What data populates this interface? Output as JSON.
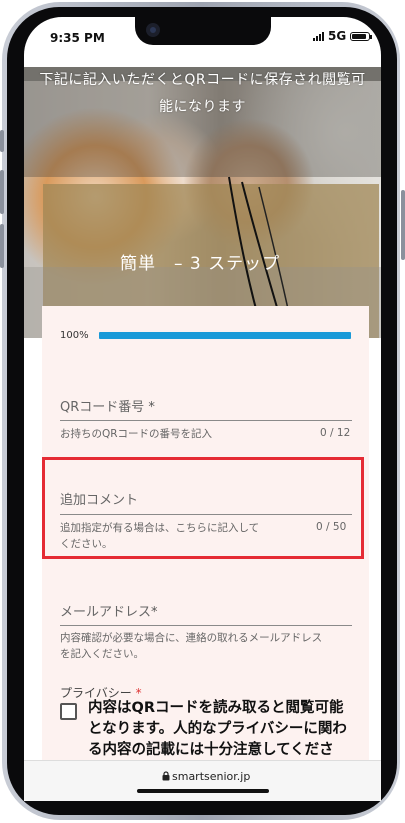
{
  "status_bar": {
    "time": "9:35 PM",
    "network": "5G"
  },
  "hero": {
    "intro_line1": "下記に記入いただくとQRコードに保存され閲覧可",
    "intro_line2": "能になります",
    "steps_title": "簡単　– 3 ステップ"
  },
  "progress": {
    "label": "100%",
    "percent": 100
  },
  "fields": {
    "qr_code": {
      "label": "QRコード番号",
      "required_mark": "*",
      "help": "お持ちのQRコードの番号を記入",
      "counter": "0 / 12"
    },
    "comment": {
      "label": "追加コメント",
      "help_line1": "追加指定が有る場合は、こちらに記入して",
      "help_line2": "ください。",
      "counter": "0 / 50"
    },
    "email": {
      "label": "メールアドレス",
      "required_mark": "*",
      "help_line1": "内容確認が必要な場合に、連絡の取れるメールアドレス",
      "help_line2": "を記入ください。"
    }
  },
  "privacy": {
    "label": "プライバシー",
    "required_mark": "*",
    "text": "内容はQRコードを読み取ると閲覧可能となります。人的なプライバシーに関わる内容の記載には十分注意してください。"
  },
  "url_bar": {
    "domain": "smartsenior.jp"
  },
  "colors": {
    "accent": "#1a9ad8",
    "highlight": "#e52b34",
    "card": "#fdf2f0"
  }
}
